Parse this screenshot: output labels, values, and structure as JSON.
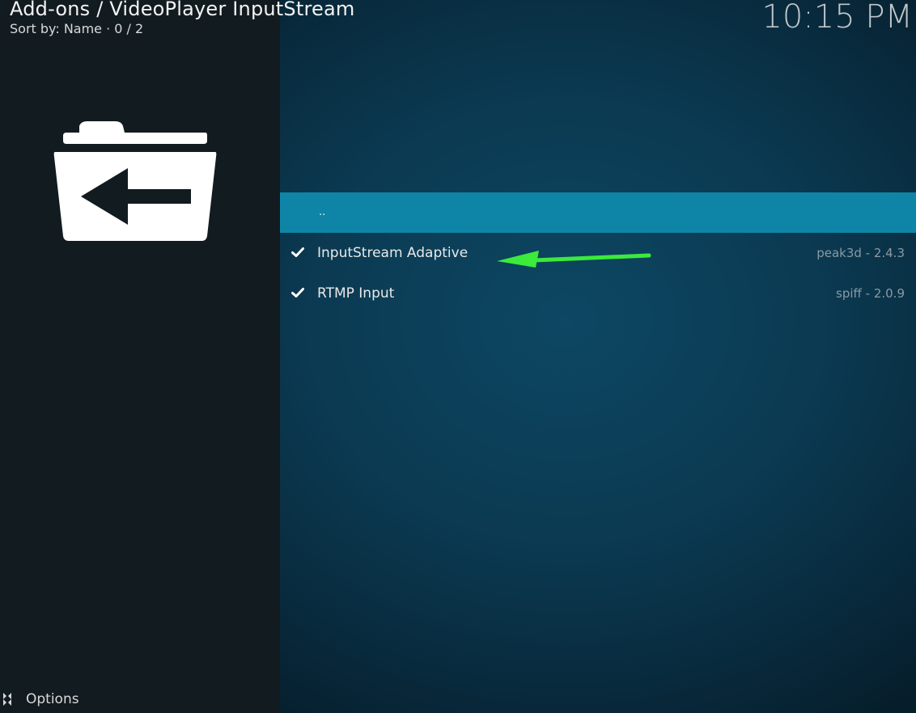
{
  "header": {
    "title": "Add-ons / VideoPlayer InputStream",
    "subtitle": "Sort by: Name  ·  0 / 2"
  },
  "clock": "10:15 PM",
  "sidebar": {
    "icon": "folder-back-icon"
  },
  "list": {
    "items": [
      {
        "label": "..",
        "meta": "",
        "checked": false,
        "selected": true
      },
      {
        "label": "InputStream Adaptive",
        "meta": "peak3d - 2.4.3",
        "checked": true,
        "selected": false
      },
      {
        "label": "RTMP Input",
        "meta": "spiff - 2.0.9",
        "checked": true,
        "selected": false
      }
    ]
  },
  "footer": {
    "options_label": "Options",
    "options_icon": "options-icon"
  },
  "colors": {
    "sidebar_bg": "#121b20",
    "selected_row": "#0e85a6",
    "annotation_arrow": "#3bea3b"
  }
}
